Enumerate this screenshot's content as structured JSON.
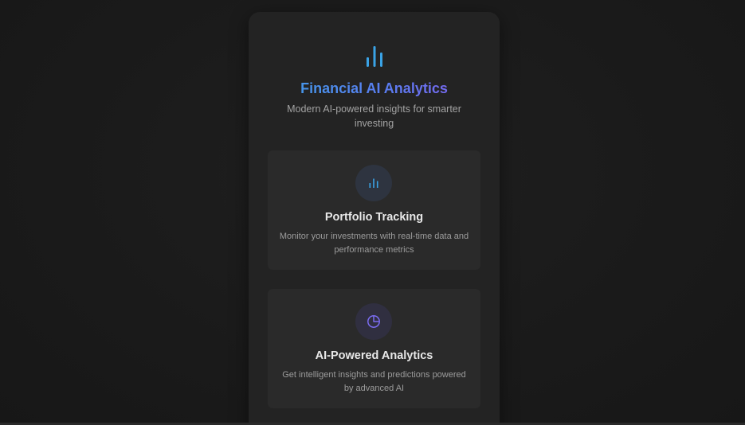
{
  "app": {
    "title": "Financial AI Analytics",
    "subtitle": "Modern AI-powered insights for smarter investing",
    "logo_icon": "bar-chart-icon",
    "accent_colors": [
      "#3aa3e6",
      "#5a7cf0",
      "#8a5cf0"
    ]
  },
  "features": [
    {
      "title": "Portfolio Tracking",
      "description": "Monitor your investments with real-time data and performance metrics",
      "icon": "bar-chart-icon",
      "icon_color": "#3aa3e6"
    },
    {
      "title": "AI-Powered Analytics",
      "description": "Get intelligent insights and predictions powered by advanced AI",
      "icon": "pie-chart-icon",
      "icon_color": "#7a6cf0"
    }
  ]
}
